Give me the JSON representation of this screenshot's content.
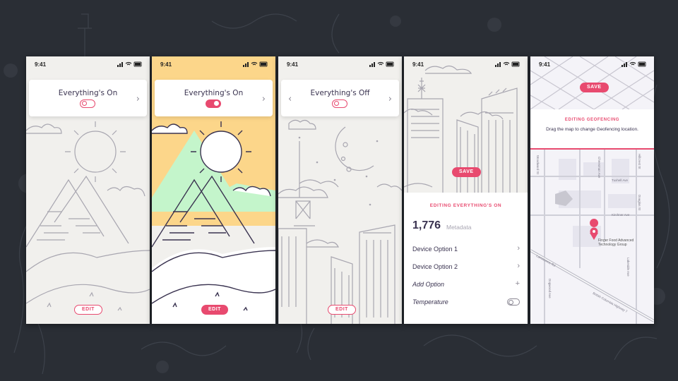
{
  "status_time": "9:41",
  "colors": {
    "accent": "#e84a6f",
    "ink": "#3a3350",
    "line": "#9c9aa6",
    "sky_day": "#fcd68a",
    "mountain_day": "#c4f5cb",
    "background": "#2a2e35"
  },
  "panels": [
    {
      "card_title": "Everything's On",
      "toggle_state": "off",
      "action_label": "EDIT",
      "theme": "day-outline"
    },
    {
      "card_title": "Everything's On",
      "toggle_state": "on",
      "action_label": "EDIT",
      "theme": "day-color"
    },
    {
      "card_title": "Everything's Off",
      "toggle_state": "off",
      "action_label": "EDIT",
      "theme": "night"
    },
    {
      "action_label": "SAVE",
      "edit_sheet": {
        "header": "EDITING EVERYTHING'S ON",
        "count": "1,776",
        "count_label": "Metadata",
        "rows": [
          {
            "label": "Device Option 1",
            "action_icon": "chevron-right-icon"
          },
          {
            "label": "Device Option 2",
            "action_icon": "chevron-right-icon"
          },
          {
            "label": "Add Option",
            "action_icon": "plus-icon"
          },
          {
            "label": "Temperature",
            "action_icon": "toggle-icon"
          }
        ]
      }
    },
    {
      "action_label": "SAVE",
      "geofence": {
        "header": "EDITING GEOFENCING",
        "description": "Drag the map to change Geofencing location.",
        "pin_label": "Finger Food Advanced Technology Group",
        "streets": [
          "Woodward St",
          "Tuxhell Ave",
          "Kirchner Ave",
          "Lakeside Ave",
          "Dogwood Ave",
          "British Columbia Highway 7",
          "Cheesman Ave",
          "Lansdowne Rd",
          "Hillcrest St",
          "Douglas St"
        ]
      }
    }
  ]
}
